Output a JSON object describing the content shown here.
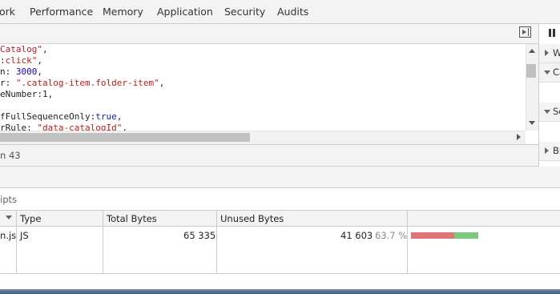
{
  "tabs": [
    {
      "label": "ork"
    },
    {
      "label": "Performance"
    },
    {
      "label": "Memory"
    },
    {
      "label": "Application"
    },
    {
      "label": "Security"
    },
    {
      "label": "Audits"
    }
  ],
  "editor": {
    "lines": [
      {
        "parts": [
          {
            "t": "",
            "c": ""
          },
          {
            "t": "Catalog\"",
            "c": "str"
          },
          {
            "t": ",",
            "c": ""
          }
        ]
      },
      {
        "parts": [
          {
            "t": ":",
            "c": ""
          },
          {
            "t": "click\"",
            "c": "str"
          },
          {
            "t": ",",
            "c": ""
          }
        ]
      },
      {
        "parts": [
          {
            "t": "n: ",
            "c": ""
          },
          {
            "t": "3000",
            "c": "num"
          },
          {
            "t": ",",
            "c": ""
          }
        ]
      },
      {
        "parts": [
          {
            "t": "r: ",
            "c": ""
          },
          {
            "t": "\".catalog-item.folder-item\"",
            "c": "str"
          },
          {
            "t": ",",
            "c": ""
          }
        ]
      },
      {
        "parts": [
          {
            "t": "eNumber:1,",
            "c": ""
          }
        ]
      },
      {
        "parts": [
          {
            "t": "",
            "c": ""
          }
        ]
      },
      {
        "parts": [
          {
            "t": "fFullSequenceOnly:",
            "c": ""
          },
          {
            "t": "true",
            "c": "kw"
          },
          {
            "t": ",",
            "c": ""
          }
        ]
      },
      {
        "parts": [
          {
            "t": "rRule: ",
            "c": ""
          },
          {
            "t": "\"data-catalogId\"",
            "c": "str"
          },
          {
            "t": ",",
            "c": ""
          }
        ]
      }
    ]
  },
  "status": {
    "text": "n 43"
  },
  "sidebar": {
    "rows": [
      {
        "label": "W",
        "expanded": false
      },
      {
        "label": "Ca",
        "expanded": true
      },
      {
        "label": "Sc",
        "expanded": true
      },
      {
        "label": "Br",
        "expanded": false
      }
    ]
  },
  "coverage": {
    "header_text": "ipts",
    "columns": [
      "Type",
      "Total Bytes",
      "Unused Bytes"
    ],
    "rows": [
      {
        "url": "n.js",
        "type": "JS",
        "total_bytes": "65 335",
        "unused_bytes": "41 603",
        "unused_percent": "63.7 %",
        "unused_fraction": 0.637
      }
    ]
  },
  "colors": {
    "used_bar": "#e07575",
    "unused_bar": "#7dca7d"
  }
}
